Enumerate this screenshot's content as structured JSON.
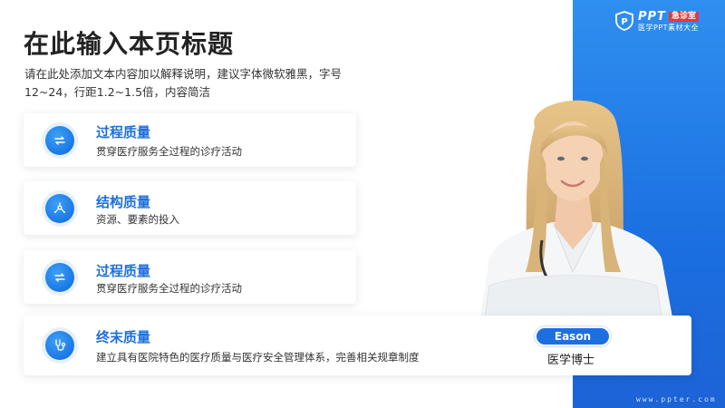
{
  "brand": {
    "name": "PPT",
    "tag": "急诊室",
    "subtitle": "医学PPT素材大全"
  },
  "header": {
    "title": "在此输入本页标题",
    "desc_line1": "请在此处添加文本内容加以解释说明，建议字体微软雅黑，字号",
    "desc_line2": "12~24，行距1.2~1.5倍，内容简洁"
  },
  "cards": [
    {
      "title": "过程质量",
      "desc": "贯穿医疗服务全过程的诊疗活动",
      "icon": "loop-arrows-icon"
    },
    {
      "title": "结构质量",
      "desc": "资源、要素的投入",
      "icon": "network-icon"
    },
    {
      "title": "过程质量",
      "desc": "贯穿医疗服务全过程的诊疗活动",
      "icon": "loop-arrows-icon"
    },
    {
      "title": "终末质量",
      "desc": "建立具有医院特色的医疗质量与医疗安全管理体系，完善相关规章制度",
      "icon": "stethoscope-icon"
    }
  ],
  "doctor": {
    "name": "Eason",
    "role": "医学博士"
  },
  "footer": {
    "website": "www.ppter.com"
  },
  "colors": {
    "accent": "#1d6fd9",
    "panel": "#1c6fe0"
  }
}
